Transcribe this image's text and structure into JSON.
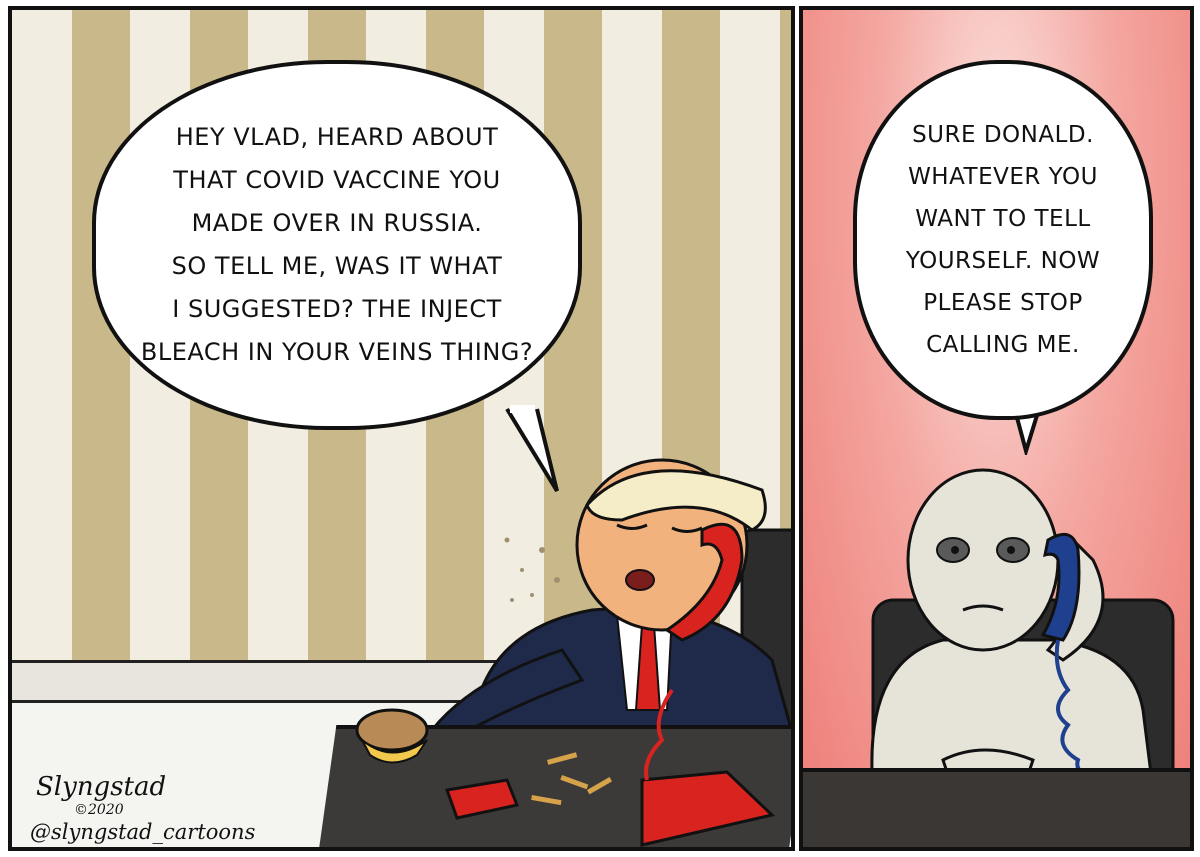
{
  "comic": {
    "left_panel": {
      "speech": "HEY VLAD, HEARD ABOUT\nTHAT COVID VACCINE YOU\nMADE OVER IN RUSSIA.\nSO TELL ME, WAS IT WHAT\nI SUGGESTED? THE INJECT\nBLEACH IN YOUR VEINS THING?",
      "colors": {
        "wall_stripe_gold": "#c9b88a",
        "wall_stripe_cream": "#f1ede1",
        "phone_red": "#d8231f",
        "suit_navy": "#1f2a4a"
      }
    },
    "right_panel": {
      "speech": "SURE DONALD.\nWHATEVER YOU\nWANT TO TELL\nYOURSELF. NOW\nPLEASE STOP\nCALLING ME.",
      "colors": {
        "background_pink": "#f4a6a0",
        "phone_blue": "#1f3f8f"
      }
    },
    "signature": {
      "name": "Slyngstad",
      "year": "©2020",
      "handle": "@slyngstad_cartoons"
    }
  }
}
